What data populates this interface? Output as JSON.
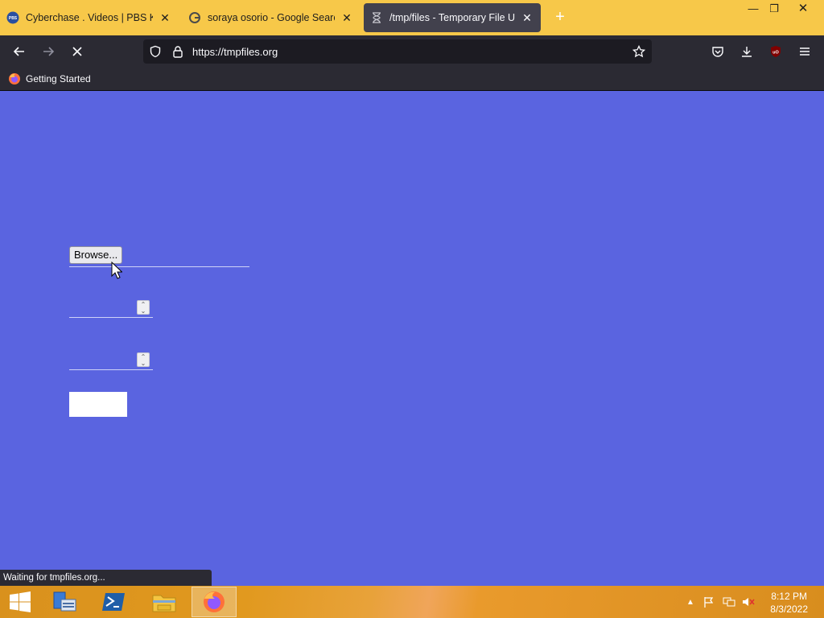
{
  "browser": {
    "tabs": [
      {
        "title": "Cyberchase . Videos | PBS KIDS",
        "favicon": "pbs-kids-icon",
        "active": false
      },
      {
        "title": "soraya osorio - Google Search",
        "favicon": "google-icon",
        "active": false
      },
      {
        "title": "/tmp/files - Temporary File Upload",
        "favicon": "hourglass-icon",
        "active": true
      }
    ],
    "new_tab_label": "+",
    "url": "https://tmpfiles.org",
    "bookmark": "Getting Started",
    "status": "Waiting for tmpfiles.org..."
  },
  "page": {
    "browse_label": "Browse...",
    "submit_label": ""
  },
  "taskbar": {
    "apps": [
      "start-icon",
      "server-manager-icon",
      "powershell-icon",
      "file-explorer-icon",
      "firefox-icon"
    ],
    "clock_time": "8:12 PM",
    "clock_date": "8/3/2022"
  },
  "colors": {
    "page_bg": "#5a64e0",
    "tabstrip_bg": "#f7c849",
    "toolbar_bg": "#2b2a33"
  }
}
